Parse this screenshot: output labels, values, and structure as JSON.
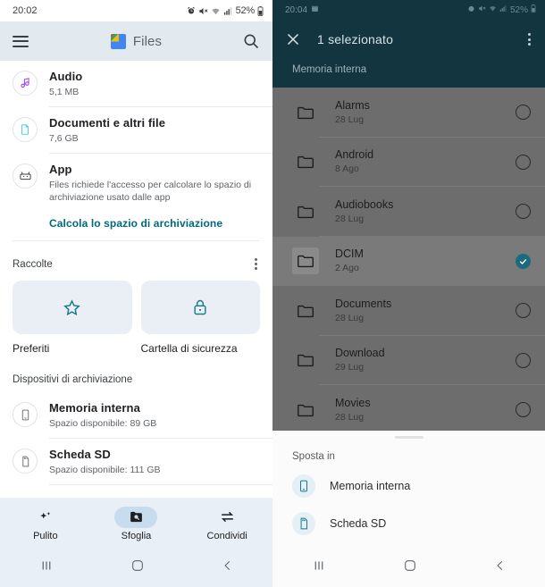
{
  "left_phone": {
    "status_bar": {
      "time": "20:02",
      "battery": "52%",
      "icons": [
        "alarm-icon",
        "mute-icon",
        "wifi-icon",
        "signal-icon",
        "battery-icon"
      ]
    },
    "app_bar": {
      "menu_icon": "hamburger-menu-icon",
      "logo_icon": "google-files-logo",
      "title": "Files",
      "search_icon": "search-icon"
    },
    "storage_categories": [
      {
        "icon": "music-note-icon",
        "title": "Audio",
        "subtitle": "5,1 MB"
      },
      {
        "icon": "document-icon",
        "title": "Documenti e altri file",
        "subtitle": "7,6 GB"
      },
      {
        "icon": "android-app-icon",
        "title": "App",
        "subtitle": "Files richiede l'accesso per calcolare lo spazio di archiviazione usato dalle app"
      }
    ],
    "compute_link": "Calcola lo spazio di archiviazione",
    "collections": {
      "heading": "Raccolte",
      "kebab_icon": "more-options-icon",
      "cards": [
        {
          "icon": "star-outline-icon",
          "label": "Preferiti"
        },
        {
          "icon": "lock-icon",
          "label": "Cartella di sicurezza"
        }
      ]
    },
    "devices": {
      "heading": "Dispositivi di archiviazione",
      "items": [
        {
          "icon": "phone-storage-icon",
          "title": "Memoria interna",
          "subtitle": "Spazio disponibile: 89 GB"
        },
        {
          "icon": "sd-card-icon",
          "title": "Scheda SD",
          "subtitle": "Spazio disponibile: 111 GB"
        }
      ]
    },
    "bottom_nav": [
      {
        "icon": "sparkle-clean-icon",
        "label": "Pulito",
        "active": false
      },
      {
        "icon": "browse-folder-icon",
        "label": "Sfoglia",
        "active": true
      },
      {
        "icon": "share-arrows-icon",
        "label": "Condividi",
        "active": false
      }
    ],
    "system_nav": {
      "recents_icon": "recents-icon",
      "home_icon": "home-icon",
      "back_icon": "back-icon"
    }
  },
  "right_phone": {
    "status_bar": {
      "time": "20:04",
      "battery": "52%",
      "icons": [
        "calendar-icon",
        "alarm-icon",
        "mute-icon",
        "wifi-icon",
        "signal-icon",
        "battery-icon"
      ]
    },
    "app_bar": {
      "close_icon": "close-icon",
      "title": "1 selezionato",
      "kebab_icon": "more-options-icon",
      "path": "Memoria interna"
    },
    "folders": [
      {
        "icon": "folder-icon",
        "name": "Alarms",
        "date": "28 Lug",
        "selected": false
      },
      {
        "icon": "folder-icon",
        "name": "Android",
        "date": "8 Ago",
        "selected": false
      },
      {
        "icon": "folder-icon",
        "name": "Audiobooks",
        "date": "28 Lug",
        "selected": false
      },
      {
        "icon": "folder-icon",
        "name": "DCIM",
        "date": "2 Ago",
        "selected": true
      },
      {
        "icon": "folder-icon",
        "name": "Documents",
        "date": "28 Lug",
        "selected": false
      },
      {
        "icon": "folder-icon",
        "name": "Download",
        "date": "29 Lug",
        "selected": false
      },
      {
        "icon": "folder-icon",
        "name": "Movies",
        "date": "28 Lug",
        "selected": false
      }
    ],
    "bottom_sheet": {
      "title": "Sposta in",
      "items": [
        {
          "icon": "phone-storage-icon",
          "label": "Memoria interna"
        },
        {
          "icon": "sd-card-icon",
          "label": "Scheda SD"
        }
      ]
    },
    "system_nav": {
      "recents_icon": "recents-icon",
      "home_icon": "home-icon",
      "back_icon": "back-icon"
    }
  },
  "colors": {
    "left_appbar": "#e2eaf0",
    "left_bottomnav": "#e8eff6",
    "left_accent": "#00697d",
    "right_header": "#123540",
    "right_list_bg": "#6d6d6d",
    "right_selected_row": "#7a7a7a",
    "right_check": "#1c6a7e",
    "sheet_bg": "#fbfbfb"
  }
}
